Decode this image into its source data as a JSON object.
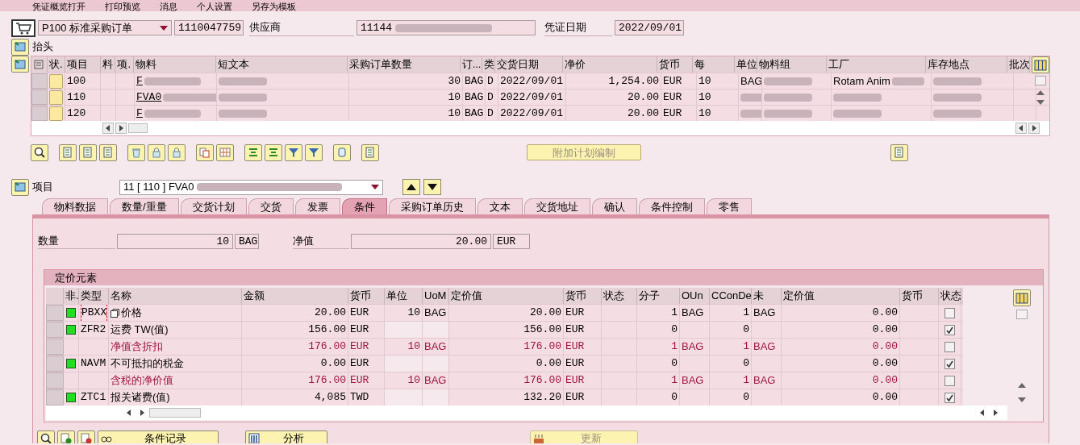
{
  "toolbar": [
    "凭证概览打开",
    "打印预览",
    "消息",
    "个人设置",
    "另存为模板"
  ],
  "header": {
    "doc_type": "P100 标准采购订单",
    "po_number": "1110047759",
    "vendor_label": "供应商",
    "vendor": "11144",
    "date_label": "凭证日期",
    "date": "2022/09/01"
  },
  "header_section": {
    "label": "抬头"
  },
  "items_table": {
    "columns": [
      "状.",
      "项目",
      "料",
      "项.",
      "物料",
      "短文本",
      "采购订单数量",
      "订...",
      "类",
      "交货日期",
      "净价",
      "货币",
      "每",
      "单位",
      "物料组",
      "工厂",
      "库存地点",
      "批次"
    ],
    "rows": [
      {
        "item": "100",
        "material": "F",
        "quantity": "30",
        "order_unit": "BAG",
        "category": "D",
        "delivery_date": "2022/09/01",
        "net_price": "1,254.00",
        "currency": "EUR",
        "per": "10",
        "unit": "BAG",
        "plant": "Rotam Anim"
      },
      {
        "item": "110",
        "material": "FVA0",
        "quantity": "10",
        "order_unit": "BAG",
        "category": "D",
        "delivery_date": "2022/09/01",
        "net_price": "20.00",
        "currency": "EUR",
        "per": "10"
      },
      {
        "item": "120",
        "material": "F",
        "quantity": "10",
        "order_unit": "BAG",
        "category": "D",
        "delivery_date": "2022/09/01",
        "net_price": "20.00",
        "currency": "EUR",
        "per": "10"
      }
    ]
  },
  "schedule_button": {
    "label": "附加计划编制",
    "disabled": true
  },
  "item_section": {
    "label": "项目",
    "selector": "11 [ 110 ] FVA0"
  },
  "tabs": [
    {
      "label": "物料数据",
      "selected": false
    },
    {
      "label": "数量/重量",
      "selected": false
    },
    {
      "label": "交货计划",
      "selected": false
    },
    {
      "label": "交货",
      "selected": false
    },
    {
      "label": "发票",
      "selected": false
    },
    {
      "label": "条件",
      "selected": true
    },
    {
      "label": "采购订单历史",
      "selected": false
    },
    {
      "label": "文本",
      "selected": false
    },
    {
      "label": "交货地址",
      "selected": false
    },
    {
      "label": "确认",
      "selected": false
    },
    {
      "label": "条件控制",
      "selected": false
    },
    {
      "label": "零售",
      "selected": false
    }
  ],
  "quantity": {
    "label": "数量",
    "value": "10",
    "unit": "BAG"
  },
  "net_value": {
    "label": "净值",
    "value": "20.00",
    "currency": "EUR"
  },
  "pricing": {
    "title": "定价元素",
    "columns": [
      "非.",
      "类型",
      "名称",
      "金额",
      "货币",
      "单位",
      "UoM",
      "定价值",
      "货币",
      "状态",
      "分子",
      "OUn",
      "CConDe",
      "未",
      "定价值",
      "货币",
      "状态"
    ],
    "rows": [
      {
        "kind": "condition",
        "type": "PBXX",
        "name": "价格",
        "amount": "20.00",
        "currency": "EUR",
        "per": "10",
        "uom": "BAG",
        "value": "20.00",
        "value_currency": "EUR",
        "numerator": "1",
        "oun": "BAG",
        "denominator": "1",
        "unit2": "BAG",
        "value2": "0.00",
        "checked": false,
        "focused": true
      },
      {
        "kind": "condition",
        "type": "ZFR2",
        "name": "运费 TW(值)",
        "amount": "156.00",
        "currency": "EUR",
        "value": "156.00",
        "value_currency": "EUR",
        "numerator": "0",
        "denominator": "0",
        "value2": "0.00",
        "checked": true
      },
      {
        "kind": "subtotal",
        "name": "净值含折扣",
        "amount": "176.00",
        "currency": "EUR",
        "per": "10",
        "uom": "BAG",
        "value": "176.00",
        "value_currency": "EUR",
        "numerator": "1",
        "oun": "BAG",
        "denominator": "1",
        "unit2": "BAG",
        "value2": "0.00",
        "checked": false
      },
      {
        "kind": "condition",
        "type": "NAVM",
        "name": "不可抵扣的税金",
        "amount": "0.00",
        "currency": "EUR",
        "value": "0.00",
        "value_currency": "EUR",
        "numerator": "0",
        "denominator": "0",
        "value2": "0.00",
        "checked": true
      },
      {
        "kind": "subtotal",
        "name": "含税的净价值",
        "amount": "176.00",
        "currency": "EUR",
        "per": "10",
        "uom": "BAG",
        "value": "176.00",
        "value_currency": "EUR",
        "numerator": "1",
        "oun": "BAG",
        "denominator": "1",
        "unit2": "BAG",
        "value2": "0.00",
        "checked": false
      },
      {
        "kind": "condition",
        "type": "ZTC1",
        "name": "报关诸费(值)",
        "amount": "4,085",
        "currency": "TWD",
        "value": "132.20",
        "value_currency": "EUR",
        "numerator": "0",
        "denominator": "0",
        "value2": "0.00",
        "checked": true
      }
    ]
  },
  "bottom_buttons": [
    {
      "label": "条件记录",
      "disabled": false
    },
    {
      "label": "分析",
      "disabled": false
    },
    {
      "label": "更新",
      "disabled": true
    }
  ]
}
